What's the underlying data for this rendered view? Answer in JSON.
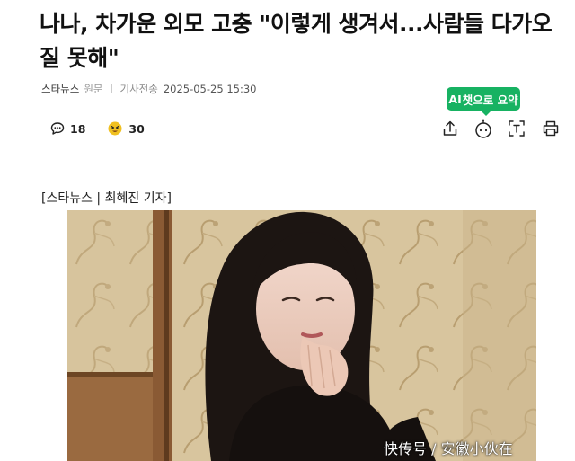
{
  "article": {
    "headline": "나나, 차가운 외모 고충 \"이렇게 생겨서...사람들 다가오질 못해\"",
    "press": "스타뉴스",
    "origin_link": "원문",
    "sent_label": "기사전송",
    "sent_datetime": "2025-05-25 15:30",
    "reporter_line": "[스타뉴스 | 최혜진 기자]"
  },
  "reactions": {
    "comment_count": "18",
    "reaction_count": "30"
  },
  "toolbar": {
    "ai_badge_prefix": "AI",
    "ai_badge_text": "챗으로 요약",
    "icons": [
      "share-icon",
      "ai-summary-icon",
      "text-size-icon",
      "print-icon"
    ]
  },
  "photo": {
    "watermark": "快传号 / 安徽小伙在"
  },
  "colors": {
    "ai_badge": "#17b262",
    "reaction_gold": "#f0c020",
    "wall_tan": "#d9c7a0",
    "hair": "#1c1512"
  }
}
